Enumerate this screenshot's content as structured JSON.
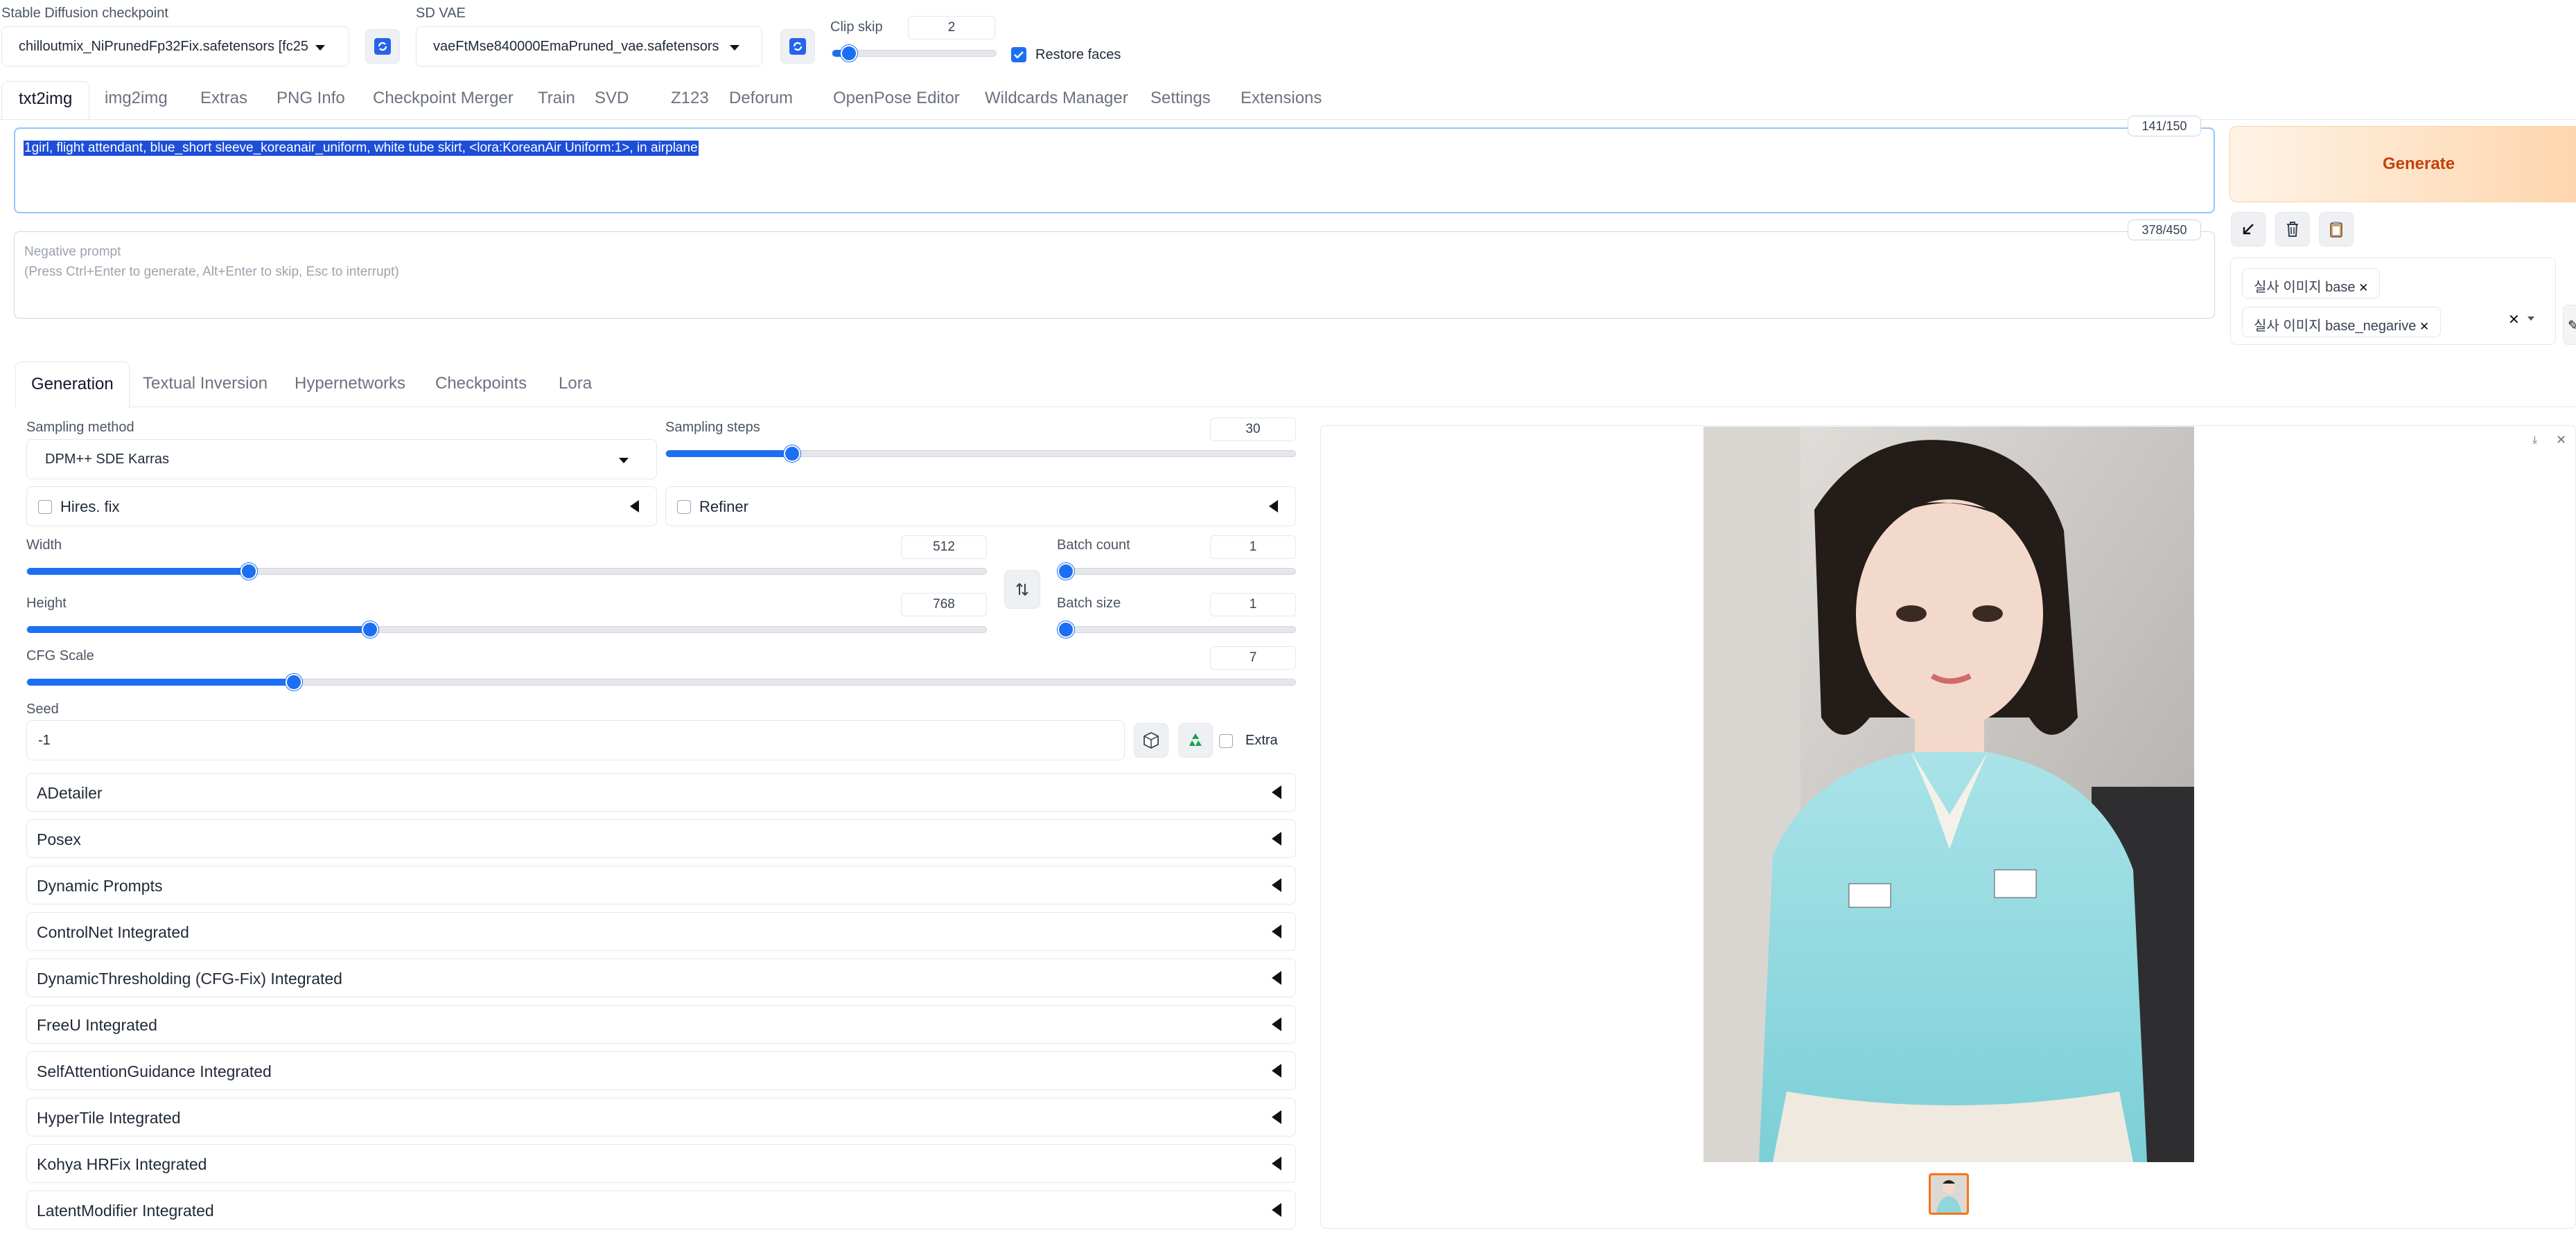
{
  "top": {
    "checkpoint_label": "Stable Diffusion checkpoint",
    "checkpoint_value": "chilloutmix_NiPrunedFp32Fix.safetensors [fc25",
    "vae_label": "SD VAE",
    "vae_value": "vaeFtMse840000EmaPruned_vae.safetensors",
    "clip_skip_label": "Clip skip",
    "clip_skip_value": "2",
    "clip_skip_level": 0.1,
    "restore_faces_label": "Restore faces",
    "restore_faces_checked": true
  },
  "tabs": [
    "txt2img",
    "img2img",
    "Extras",
    "PNG Info",
    "Checkpoint Merger",
    "Train",
    "SVD",
    "Z123",
    "Deforum",
    "OpenPose Editor",
    "Wildcards Manager",
    "Settings",
    "Extensions"
  ],
  "prompt": {
    "text": "1girl, flight attendant, blue_short sleeve_koreanair_uniform,  white tube skirt, <lora:KoreanAir Uniform:1>, in airplane",
    "counter": "141/150"
  },
  "negative": {
    "placeholder_line1": "Negative prompt",
    "placeholder_line2": "(Press Ctrl+Enter to generate, Alt+Enter to skip, Esc to interrupt)",
    "counter": "378/450"
  },
  "actions": {
    "generate_label": "Generate"
  },
  "styles": {
    "chips": [
      "실사 이미지 base",
      "실사 이미지 base_negarive"
    ],
    "clear_symbol": "✕"
  },
  "subtabs": [
    "Generation",
    "Textual Inversion",
    "Hypernetworks",
    "Checkpoints",
    "Lora"
  ],
  "params": {
    "sampling_method_label": "Sampling method",
    "sampling_method_value": "DPM++ SDE Karras",
    "sampling_steps_label": "Sampling steps",
    "sampling_steps_value": "30",
    "sampling_steps_level": 0.2,
    "hires_label": "Hires. fix",
    "refiner_label": "Refiner",
    "width_label": "Width",
    "width_value": "512",
    "width_level": 0.231,
    "height_label": "Height",
    "height_value": "768",
    "height_level": 0.357,
    "batch_count_label": "Batch count",
    "batch_count_value": "1",
    "batch_count_level": 0.0,
    "batch_size_label": "Batch size",
    "batch_size_value": "1",
    "batch_size_level": 0.0,
    "cfg_label": "CFG Scale",
    "cfg_value": "7",
    "cfg_level": 0.21,
    "seed_label": "Seed",
    "seed_value": "-1",
    "extra_label": "Extra"
  },
  "accordions": [
    "ADetailer",
    "Posex",
    "Dynamic Prompts",
    "ControlNet Integrated",
    "DynamicThresholding (CFG-Fix) Integrated",
    "FreeU Integrated",
    "SelfAttentionGuidance Integrated",
    "HyperTile Integrated",
    "Kohya HRFix Integrated",
    "LatentModifier Integrated"
  ],
  "colors": {
    "accent": "#1d6ff2",
    "generate_text": "#c2410c",
    "generate_bg": "#fdd6ae"
  }
}
